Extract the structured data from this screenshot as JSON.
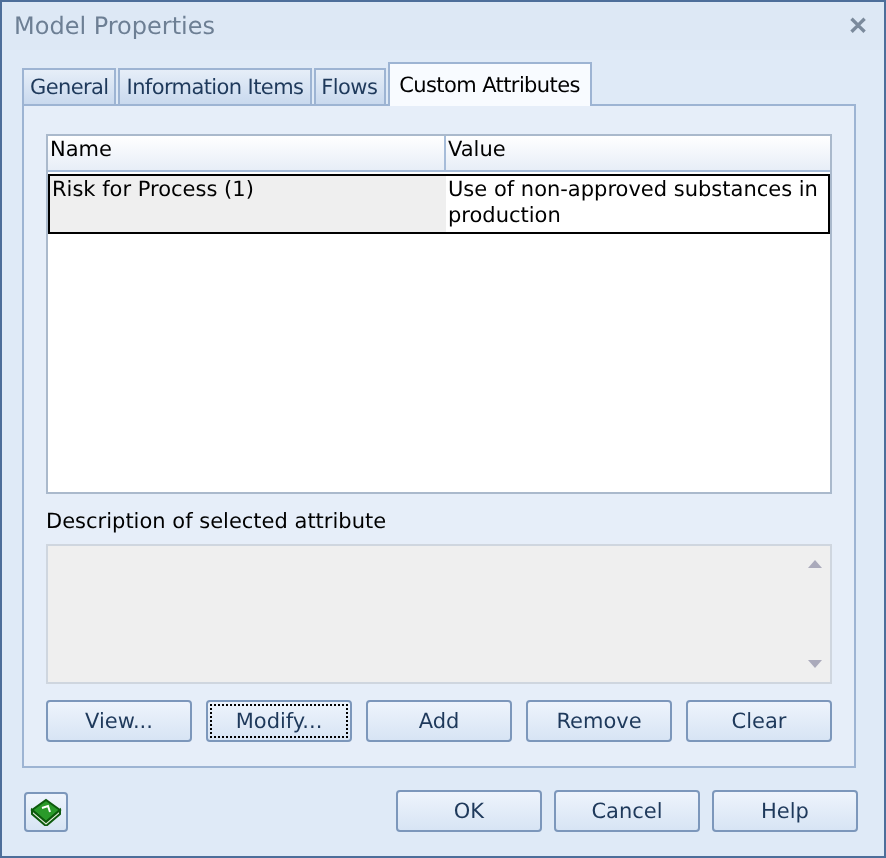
{
  "window": {
    "title": "Model Properties",
    "close": "✕"
  },
  "tabs": [
    {
      "label": "General",
      "selected": false
    },
    {
      "label": "Information Items",
      "selected": false
    },
    {
      "label": "Flows",
      "selected": false
    },
    {
      "label": "Custom Attributes",
      "selected": true
    }
  ],
  "table": {
    "columns": [
      "Name",
      "Value"
    ],
    "rows": [
      {
        "cells": [
          "Risk for Process (1)",
          "Use of non-approved substances in production"
        ],
        "selected": true
      }
    ]
  },
  "description": {
    "label": "Description of selected attribute"
  },
  "actions": [
    {
      "label": "View...",
      "focused": false
    },
    {
      "label": "Modify...",
      "focused": true
    },
    {
      "label": "Add",
      "focused": false
    },
    {
      "label": "Remove",
      "focused": false
    },
    {
      "label": "Clear",
      "focused": false
    }
  ],
  "buttons": [
    "OK",
    "Cancel",
    "Help"
  ]
}
